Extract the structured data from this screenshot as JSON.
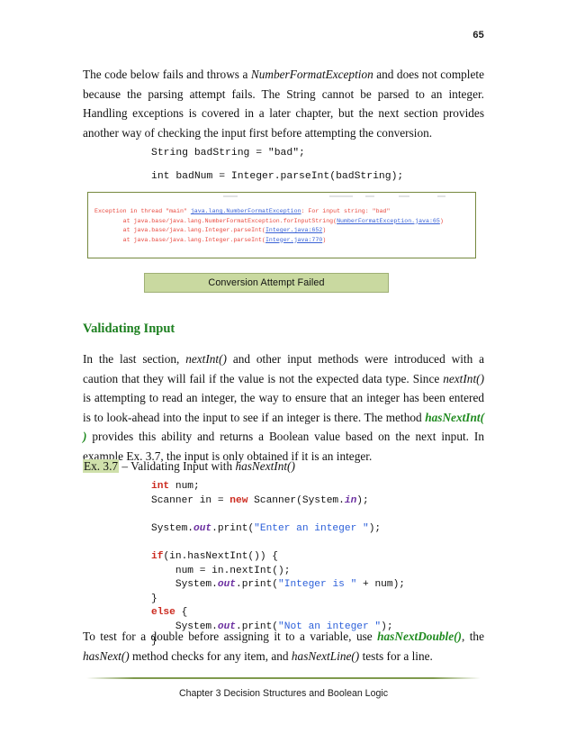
{
  "page": {
    "number": "65"
  },
  "paragraphs": {
    "intro_1": "The code below fails and throws a ",
    "intro_em": "NumberFormatException",
    "intro_2": " and does not complete because the parsing attempt fails.  The String cannot be parsed to an integer.  Handling exceptions is covered in a later chapter, but the next section provides another way of checking the input first before attempting the conversion.",
    "validating_1": "In the last section, ",
    "validating_em1": "nextInt()",
    "validating_2": " and other input methods were introduced with a caution that they will fail if the value is not the expected data type.  Since ",
    "validating_em2": "nextInt()",
    "validating_3": " is attempting to read an integer, the way to ensure that an integer has been entered is to look-ahead into the input to see if an integer is there.  The method ",
    "validating_green": "hasNextInt( )",
    "validating_4": " provides this ability and returns a Boolean value based on the next input.  In example Ex. 3.7, the input is only obtained if it is an integer.",
    "example_tag": "Ex. 3.7",
    "example_label_1": " – Validating Input with ",
    "example_label_em": "hasNextInt()",
    "closing_1": "To test for a double before assigning it to a variable, use ",
    "closing_green": "hasNextDouble()",
    "closing_2": ", the ",
    "closing_em1": "hasNext()",
    "closing_3": " method checks for any item, and ",
    "closing_em2": "hasNextLine()",
    "closing_4": " tests for a line."
  },
  "section": {
    "heading": "Validating Input"
  },
  "code_plain": {
    "line_1": "String badString = \"bad\";",
    "line_2": "int badNum = Integer.parseInt(badString);"
  },
  "console": {
    "line_1_a": "Exception in thread \"main\" ",
    "line_1_link": "java.lang.NumberFormatException",
    "line_1_b": ": For input string: \"bad\"",
    "line_2_a": "        at java.base/java.lang.NumberFormatException.forInputString(",
    "line_2_link": "NumberFormatException.java:65",
    "line_2_b": ")",
    "line_3_a": "        at java.base/java.lang.Integer.parseInt(",
    "line_3_link": "Integer.java:652",
    "line_3_b": ")",
    "line_4_a": "        at java.base/java.lang.Integer.parseInt(",
    "line_4_link": "Integer.java:770",
    "line_4_b": ")"
  },
  "caption": {
    "text": "Conversion Attempt Failed"
  },
  "code_java": {
    "l01_kw": "int",
    "l01_rest": " num;",
    "l02_a": "Scanner in = ",
    "l02_kw": "new",
    "l02_b": " Scanner(System.",
    "l02_fld": "in",
    "l02_c": ");",
    "l03": "",
    "l04_a": "System.",
    "l04_fld": "out",
    "l04_b": ".print(",
    "l04_str": "\"Enter an integer \"",
    "l04_c": ");",
    "l05": "",
    "l06_kw": "if",
    "l06_rest": "(in.hasNextInt()) {",
    "l07": "    num = in.nextInt();",
    "l08_a": "    System.",
    "l08_fld": "out",
    "l08_b": ".print(",
    "l08_str": "\"Integer is \"",
    "l08_c": " + num);",
    "l09": "}",
    "l10_kw": "else",
    "l10_rest": " {",
    "l11_a": "    System.",
    "l11_fld": "out",
    "l11_b": ".print(",
    "l11_str": "\"Not an integer \"",
    "l11_c": ");",
    "l12": "}"
  },
  "footer": {
    "text": "Chapter 3 Decision Structures and Boolean Logic"
  },
  "colors": {
    "heading_green": "#1d8020",
    "inline_green": "#1f8a1f",
    "caption_fill": "#c9d9a0",
    "caption_border": "#9fb075",
    "console_border": "#76893f",
    "console_error": "#e8493f",
    "console_link": "#3b63d6",
    "footer_rule": "#7f9a4e",
    "code_keyword": "#cc2a1f",
    "code_string": "#2b5fd9",
    "code_field": "#6b2fa0"
  }
}
